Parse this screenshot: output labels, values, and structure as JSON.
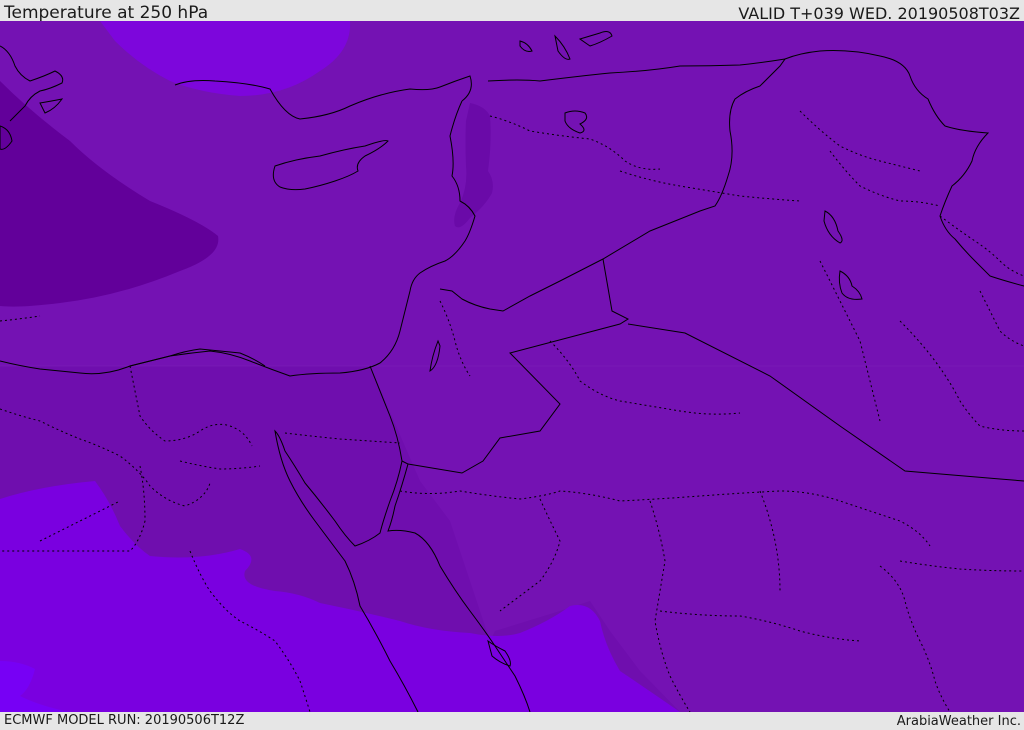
{
  "header": {
    "title": "Temperature at 250 hPa",
    "valid_time": "VALID T+039 WED. 20190508T03Z"
  },
  "footer": {
    "model_run": "ECMWF MODEL RUN: 20190506T12Z",
    "credit": "ArabiaWeather Inc."
  },
  "colors": {
    "field_main": "#7412b3",
    "field_cold_core": "#62009a",
    "field_cold_mid": "#6a0aa8",
    "field_warm_1": "#8005d6",
    "field_warm_2": "#7a00e0",
    "field_warm_3": "#7700f5",
    "coastline": "#000000"
  }
}
